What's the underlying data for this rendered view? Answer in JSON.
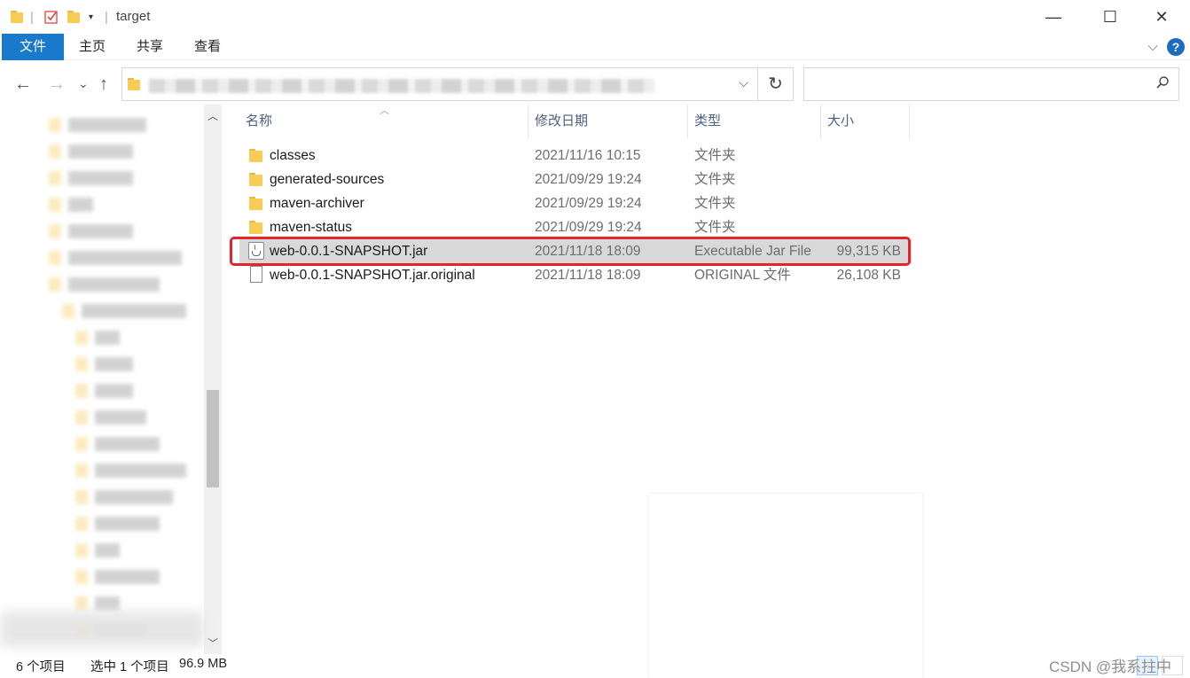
{
  "window": {
    "title": "target",
    "minimize": "—",
    "maximize": "☐",
    "close": "✕"
  },
  "ribbon": {
    "tabs": [
      "文件",
      "主页",
      "共享",
      "查看"
    ],
    "collapse": "⌵",
    "help": "?"
  },
  "nav": {
    "back": "←",
    "forward": "→",
    "recent": "⌄",
    "up": "↑",
    "address_dropdown": "⌵",
    "refresh": "↻",
    "search_placeholder": ""
  },
  "columns": {
    "name": "名称",
    "date": "修改日期",
    "type": "类型",
    "size": "大小"
  },
  "files": [
    {
      "name": "classes",
      "date": "2021/11/16 10:15",
      "type": "文件夹",
      "size": "",
      "icon": "folder-icon"
    },
    {
      "name": "generated-sources",
      "date": "2021/09/29 19:24",
      "type": "文件夹",
      "size": "",
      "icon": "folder-icon"
    },
    {
      "name": "maven-archiver",
      "date": "2021/09/29 19:24",
      "type": "文件夹",
      "size": "",
      "icon": "folder-icon"
    },
    {
      "name": "maven-status",
      "date": "2021/09/29 19:24",
      "type": "文件夹",
      "size": "",
      "icon": "folder-icon"
    },
    {
      "name": "web-0.0.1-SNAPSHOT.jar",
      "date": "2021/11/18 18:09",
      "type": "Executable Jar File",
      "size": "99,315 KB",
      "icon": "java-jar-icon",
      "selected": true
    },
    {
      "name": "web-0.0.1-SNAPSHOT.jar.original",
      "date": "2021/11/18 18:09",
      "type": "ORIGINAL 文件",
      "size": "26,108 KB",
      "icon": "file-icon"
    }
  ],
  "status": {
    "item_count": "6 个项目",
    "selected": "选中 1 个项目",
    "selected_size": "96.9 MB"
  },
  "watermark": "CSDN @我系拄中",
  "colors": {
    "accent": "#1979ca",
    "highlight_border": "#e3262b",
    "selection": "#d9d9d9",
    "folder": "#f7cd56"
  }
}
